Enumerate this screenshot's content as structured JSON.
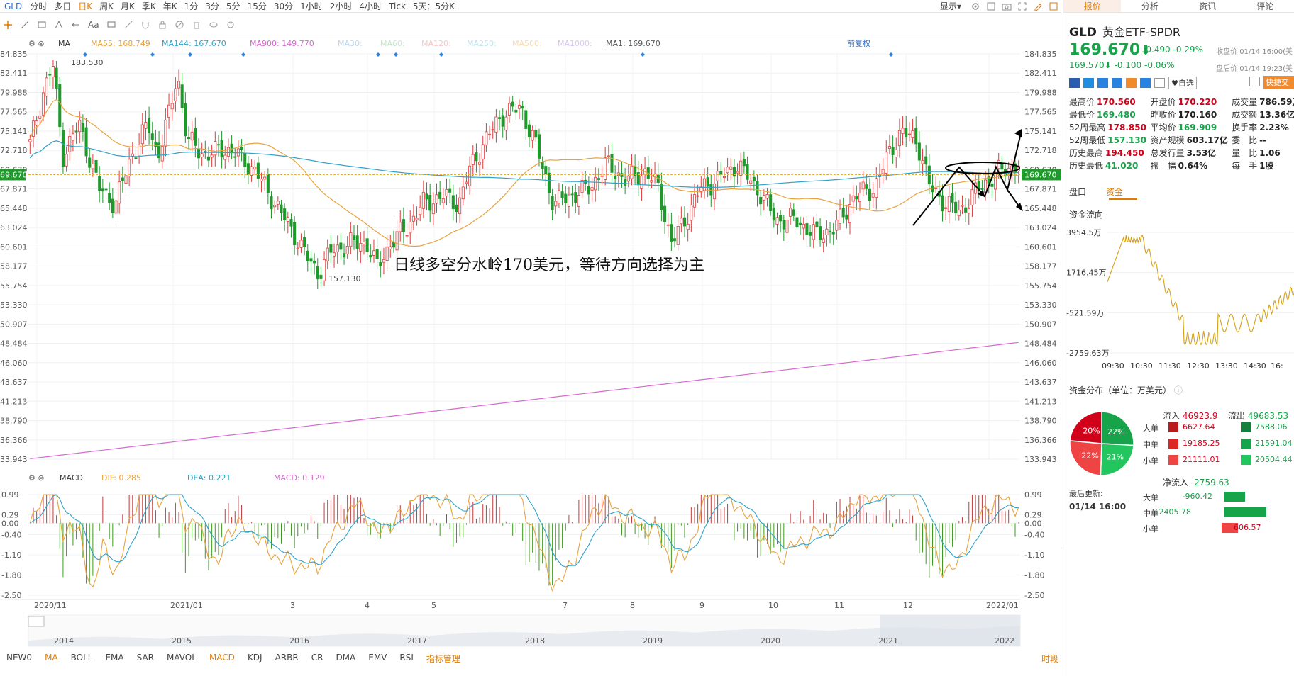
{
  "topbar": {
    "symbol": "GLD",
    "periods": [
      "分时",
      "多日",
      "日K",
      "周K",
      "月K",
      "季K",
      "年K",
      "1分",
      "3分",
      "5分",
      "15分",
      "30分",
      "1小时",
      "2小时",
      "4小时",
      "Tick",
      "5天：5分K"
    ],
    "active_period": "日K",
    "display_label": "显示"
  },
  "toolbar": {
    "text_tool_label": "Aa"
  },
  "indicator_main": {
    "name": "MA",
    "ma55": "MA55: 168.749",
    "ma144": "MA144: 167.670",
    "ma900": "MA900: 149.770",
    "ma30": "MA30:",
    "ma60": "MA60:",
    "ma120": "MA120:",
    "ma250": "MA250:",
    "ma500": "MA500:",
    "ma1000": "MA1000:",
    "ma1": "MA1: 169.670",
    "adjust_label": "前复权",
    "colors": {
      "ma55": "#e8a33d",
      "ma144": "#2fa2c9",
      "ma900": "#d66ad0",
      "faded": "#bcd7f0",
      "up": "#e13b3b",
      "down": "#1e9a2b"
    }
  },
  "annotation": "日线多空分水岭170美元，等待方向选择为主",
  "price_axis": {
    "labels": [
      "184.835",
      "182.411",
      "179.988",
      "177.565",
      "175.141",
      "172.718",
      "169.670",
      "167.871",
      "165.448",
      "163.024",
      "160.601",
      "158.177",
      "155.754",
      "153.330",
      "150.907",
      "148.484",
      "146.060",
      "143.637",
      "141.213",
      "138.790",
      "136.366",
      "133.943"
    ],
    "left_labels": [
      "84.835",
      "82.411",
      "79.988",
      "77.565",
      "75.141",
      "72.718",
      "69.670",
      "67.871",
      "65.448",
      "63.024",
      "60.601",
      "58.177",
      "55.754",
      "53.330",
      "50.907",
      "48.484",
      "46.060",
      "43.637",
      "41.213",
      "38.790",
      "36.366",
      "33.943"
    ],
    "current": "169.670",
    "high_label": "183.530",
    "low_label": "157.130"
  },
  "macd": {
    "name": "MACD",
    "dif": "DIF: 0.285",
    "dea": "DEA: 0.221",
    "macd": "MACD: 0.129",
    "axis_labels": [
      "0.99",
      "0.29",
      "0.00",
      "-0.40",
      "-1.10",
      "-1.80",
      "-2.50"
    ]
  },
  "date_axis": [
    "2020/11",
    "2021/01",
    "3",
    "4",
    "5",
    "7",
    "8",
    "9",
    "10",
    "11",
    "12",
    "2022/01"
  ],
  "overview_years": [
    "2014",
    "2015",
    "2016",
    "2017",
    "2018",
    "2019",
    "2020",
    "2021",
    "2022"
  ],
  "bottom_tabs": [
    "NEW0",
    "MA",
    "BOLL",
    "EMA",
    "SAR",
    "MAVOL",
    "MACD",
    "KDJ",
    "ARBR",
    "CR",
    "DMA",
    "EMV",
    "RSI",
    "指标管理"
  ],
  "bottom_active": [
    "MA",
    "MACD"
  ],
  "bottom_right": "时段",
  "right_panel": {
    "tabs": [
      "报价",
      "分析",
      "资讯",
      "评论"
    ],
    "active_tab": "报价",
    "ticker": "GLD",
    "name": "黄金ETF-SPDR",
    "price": "169.670",
    "change": "-0.490",
    "change_pct": "-0.29%",
    "close_time": "收盘价 01/14 16:00(美",
    "after_price": "169.570",
    "after_change": "-0.100",
    "after_pct": "-0.06%",
    "after_time": "盘后价 01/14 19:23(美",
    "watch_label": "自选",
    "trade_label": "快捷交",
    "stats": [
      [
        {
          "l": "最高价",
          "v": "170.560",
          "c": "red"
        },
        {
          "l": "开盘价",
          "v": "170.220",
          "c": "red"
        },
        {
          "l": "成交量",
          "v": "786.59万",
          "c": "dark"
        }
      ],
      [
        {
          "l": "最低价",
          "v": "169.480",
          "c": "green"
        },
        {
          "l": "昨收价",
          "v": "170.160",
          "c": "dark"
        },
        {
          "l": "成交额",
          "v": "13.36亿",
          "c": "dark"
        }
      ],
      [
        {
          "l": "52周最高",
          "v": "178.850",
          "c": "red"
        },
        {
          "l": "平均价",
          "v": "169.909",
          "c": "green"
        },
        {
          "l": "换手率",
          "v": "2.23%",
          "c": "dark"
        }
      ],
      [
        {
          "l": "52周最低",
          "v": "157.130",
          "c": "green"
        },
        {
          "l": "资产规模",
          "v": "603.17亿",
          "c": "dark"
        },
        {
          "l": "委　比",
          "v": "--",
          "c": "dark"
        }
      ],
      [
        {
          "l": "历史最高",
          "v": "194.450",
          "c": "red"
        },
        {
          "l": "总发行量",
          "v": "3.53亿",
          "c": "dark"
        },
        {
          "l": "量　比",
          "v": "1.06",
          "c": "dark"
        }
      ],
      [
        {
          "l": "历史最低",
          "v": "41.020",
          "c": "green"
        },
        {
          "l": "振　幅",
          "v": "0.64%",
          "c": "dark"
        },
        {
          "l": "每　手",
          "v": "1股",
          "c": "dark"
        }
      ]
    ],
    "subtabs": [
      "盘口",
      "资金"
    ],
    "active_subtab": "资金",
    "flow_title": "资金流向",
    "flow_axis": [
      "3954.5万",
      "1716.45万",
      "-521.59万",
      "-2759.63万"
    ],
    "flow_times": [
      "09:30",
      "10:30",
      "11:30",
      "12:30",
      "13:30",
      "14:30",
      "16:"
    ],
    "dist_title": "资金分布（单位：万美元）",
    "pie": [
      {
        "label": "22%",
        "value": 22,
        "color": "#16a34a"
      },
      {
        "label": "21%",
        "value": 21,
        "color": "#22c55e"
      },
      {
        "label": "22%",
        "value": 22,
        "color": "#ef4444"
      },
      {
        "label": "20%",
        "value": 20,
        "color": "#d0021b"
      }
    ],
    "inflow_label": "流入",
    "inflow_total": "46923.9",
    "outflow_label": "流出",
    "outflow_total": "49683.53",
    "rows": [
      {
        "name": "大单",
        "in": "6627.64",
        "out": "7588.06"
      },
      {
        "name": "中单",
        "in": "19185.25",
        "out": "21591.04"
      },
      {
        "name": "小单",
        "in": "21111.01",
        "out": "20504.44"
      }
    ],
    "update_label": "最后更新:",
    "update_time": "01/14 16:00",
    "net_label": "净流入",
    "net_total": "-2759.63",
    "net_rows": [
      {
        "name": "大单",
        "v": "-960.42",
        "w": 0.28,
        "c": "#16a34a"
      },
      {
        "name": "中单",
        "v": "-2405.78",
        "w": 0.72,
        "c": "#16a34a"
      },
      {
        "name": "小单",
        "v": "606.57",
        "w": 0.18,
        "c": "#ef4444"
      }
    ]
  }
}
